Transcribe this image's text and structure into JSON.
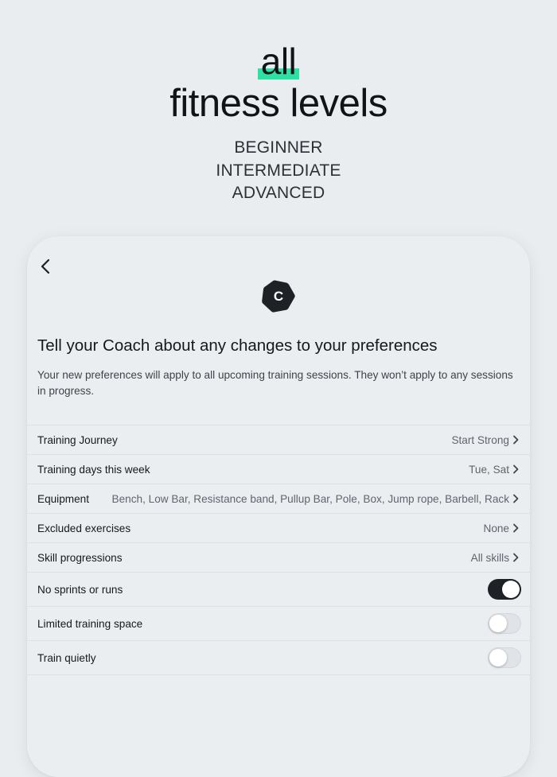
{
  "hero": {
    "highlight_word": "all",
    "subtitle": "fitness levels",
    "levels": [
      "BEGINNER",
      "INTERMEDIATE",
      "ADVANCED"
    ],
    "highlight_color": "#2fe0a3"
  },
  "sheet": {
    "logo_letter": "C",
    "title": "Tell your Coach about any changes to your preferences",
    "description": "Your new preferences will apply to all upcoming training sessions. They won’t apply to any sessions in progress.",
    "preferences": [
      {
        "label": "Training Journey",
        "value": "Start Strong"
      },
      {
        "label": "Training days this week",
        "value": "Tue, Sat"
      },
      {
        "label": "Equipment",
        "value": "Bench, Low Bar, Resistance band, Pullup Bar, Pole, Box, Jump rope, Barbell, Rack"
      },
      {
        "label": "Excluded exercises",
        "value": "None"
      },
      {
        "label": "Skill progressions",
        "value": "All skills"
      }
    ],
    "toggles": [
      {
        "label": "No sprints or runs",
        "on": true
      },
      {
        "label": "Limited training space",
        "on": false
      },
      {
        "label": "Train quietly",
        "on": false
      }
    ]
  },
  "icons": {
    "back": "chevron-left-icon",
    "row_arrow": "chevron-right-icon",
    "logo": "hexagon-logo-icon"
  },
  "colors": {
    "background": "#eaedf0",
    "toggle_on": "#1e2226",
    "toggle_off": "#e0e3e7",
    "logo": "#1e2226"
  }
}
